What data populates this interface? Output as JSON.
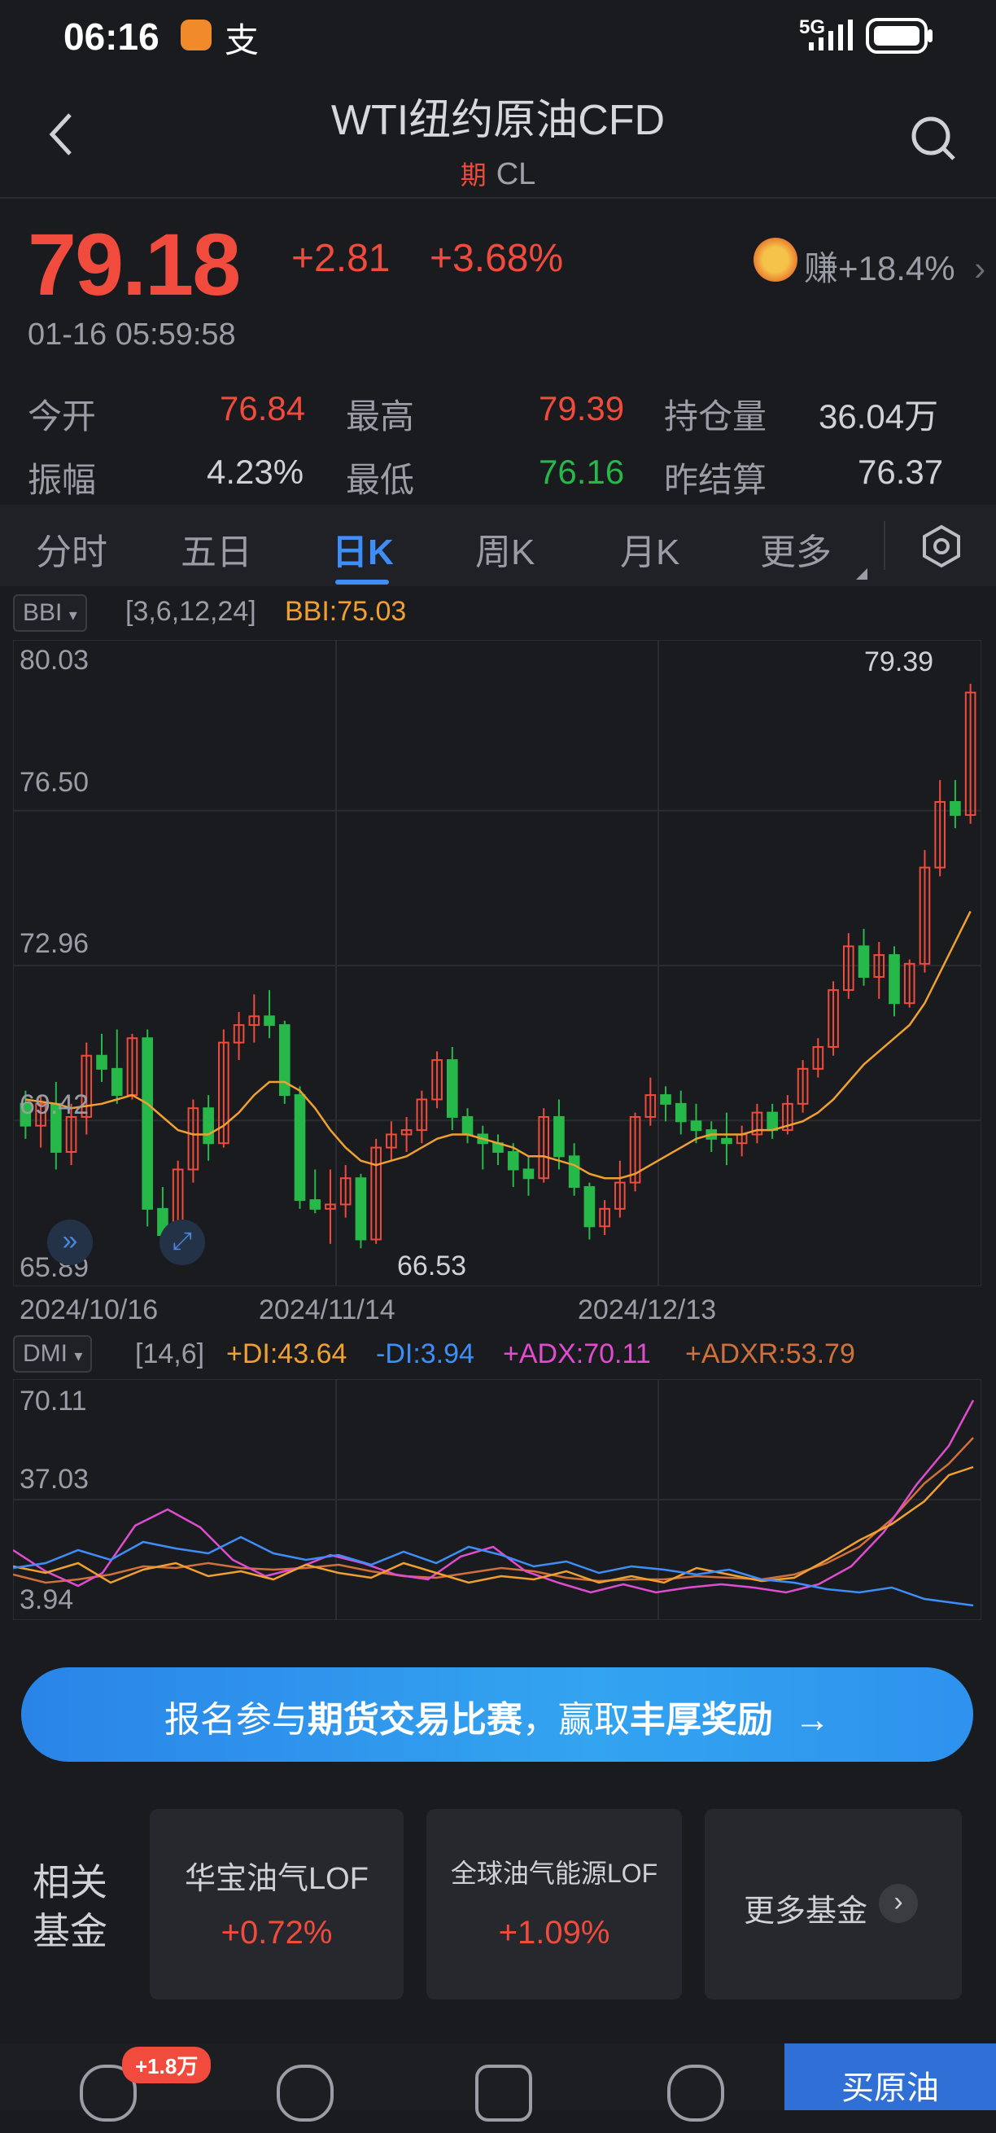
{
  "status_bar": {
    "time": "06:16",
    "signal": "5G"
  },
  "header": {
    "title": "WTI纽约原油CFD",
    "badge": "期",
    "code": "CL"
  },
  "quote": {
    "price": "79.18",
    "change": "+2.81",
    "change_pct": "+3.68%",
    "timestamp": "01-16 05:59:58",
    "earn_label": "赚+18.4%"
  },
  "stats": [
    {
      "label": "今开",
      "value": "76.84",
      "color": "red"
    },
    {
      "label": "最高",
      "value": "79.39",
      "color": "red"
    },
    {
      "label": "持仓量",
      "value": "36.04万",
      "color": "neutral"
    },
    {
      "label": "振幅",
      "value": "4.23%",
      "color": "neutral"
    },
    {
      "label": "最低",
      "value": "76.16",
      "color": "green"
    },
    {
      "label": "昨结算",
      "value": "76.37",
      "color": "neutral"
    }
  ],
  "tabs": [
    "分时",
    "五日",
    "日K",
    "周K",
    "月K",
    "更多"
  ],
  "active_tab": "日K",
  "main_indicator": {
    "name": "BBI",
    "params": "[3,6,12,24]",
    "value": "BBI:75.03"
  },
  "price_axis": [
    "80.03",
    "76.50",
    "72.96",
    "69.42",
    "65.89"
  ],
  "max_marker": "79.39",
  "min_marker": "66.53",
  "date_axis": [
    "2024/10/16",
    "2024/11/14",
    "2024/12/13"
  ],
  "dmi": {
    "name": "DMI",
    "params": "[14,6]",
    "pdi": "+DI:43.64",
    "mdi": "-DI:3.94",
    "adx": "+ADX:70.11",
    "adxr": "+ADXR:53.79",
    "axis": [
      "70.11",
      "37.03",
      "3.94"
    ]
  },
  "colors": {
    "up": "#f04b3c",
    "down": "#27b84a",
    "bbi": "#f0a030",
    "pdi": "#f0a030",
    "mdi": "#3e8ef7",
    "adx": "#e04cd0",
    "adxr": "#d0703a",
    "accent": "#3e8ef7"
  },
  "chart_data": {
    "type": "candlestick",
    "ylim": [
      65.89,
      80.03
    ],
    "ohlc": [
      [
        69.8,
        70.1,
        69.0,
        69.3
      ],
      [
        69.3,
        70.0,
        68.8,
        69.8
      ],
      [
        69.8,
        70.3,
        68.3,
        68.7
      ],
      [
        68.7,
        69.8,
        68.4,
        69.5
      ],
      [
        69.5,
        71.2,
        69.1,
        70.9
      ],
      [
        70.9,
        71.4,
        70.3,
        70.6
      ],
      [
        70.6,
        71.5,
        69.8,
        70.0
      ],
      [
        70.0,
        71.4,
        69.9,
        71.3
      ],
      [
        71.3,
        71.5,
        67.0,
        67.4
      ],
      [
        67.4,
        67.9,
        66.6,
        66.8
      ],
      [
        66.8,
        68.5,
        66.5,
        68.3
      ],
      [
        68.3,
        69.9,
        68.0,
        69.7
      ],
      [
        69.7,
        70.0,
        68.5,
        68.9
      ],
      [
        68.9,
        71.5,
        68.8,
        71.2
      ],
      [
        71.2,
        71.9,
        70.8,
        71.6
      ],
      [
        71.6,
        72.3,
        71.2,
        71.8
      ],
      [
        71.8,
        72.4,
        71.3,
        71.6
      ],
      [
        71.6,
        71.7,
        69.8,
        70.0
      ],
      [
        70.0,
        70.2,
        67.4,
        67.6
      ],
      [
        67.6,
        68.3,
        67.3,
        67.4
      ],
      [
        67.4,
        68.3,
        66.6,
        67.5
      ],
      [
        67.5,
        68.4,
        67.2,
        68.1
      ],
      [
        68.1,
        68.2,
        66.5,
        66.7
      ],
      [
        66.7,
        69.0,
        66.6,
        68.8
      ],
      [
        68.8,
        69.4,
        68.5,
        69.1
      ],
      [
        69.1,
        69.5,
        68.7,
        69.2
      ],
      [
        69.2,
        70.1,
        68.9,
        69.9
      ],
      [
        69.9,
        71.0,
        69.7,
        70.8
      ],
      [
        70.8,
        71.1,
        69.2,
        69.5
      ],
      [
        69.5,
        69.7,
        68.9,
        69.1
      ],
      [
        69.1,
        69.3,
        68.3,
        68.9
      ],
      [
        68.9,
        69.1,
        68.4,
        68.7
      ],
      [
        68.7,
        68.9,
        67.9,
        68.3
      ],
      [
        68.3,
        68.6,
        67.7,
        68.1
      ],
      [
        68.1,
        69.7,
        68.0,
        69.5
      ],
      [
        69.5,
        69.9,
        68.3,
        68.6
      ],
      [
        68.6,
        68.9,
        67.7,
        67.9
      ],
      [
        67.9,
        68.0,
        66.7,
        67.0
      ],
      [
        67.0,
        67.6,
        66.8,
        67.4
      ],
      [
        67.4,
        68.5,
        67.2,
        68.0
      ],
      [
        68.0,
        69.6,
        67.8,
        69.5
      ],
      [
        69.5,
        70.4,
        69.3,
        70.0
      ],
      [
        70.0,
        70.2,
        69.4,
        69.8
      ],
      [
        69.8,
        70.1,
        69.1,
        69.4
      ],
      [
        69.4,
        69.8,
        68.9,
        69.2
      ],
      [
        69.2,
        69.4,
        68.7,
        69.0
      ],
      [
        69.0,
        69.6,
        68.4,
        68.9
      ],
      [
        68.9,
        69.3,
        68.6,
        69.1
      ],
      [
        69.1,
        69.8,
        68.9,
        69.6
      ],
      [
        69.6,
        69.8,
        69.0,
        69.2
      ],
      [
        69.2,
        70.0,
        69.1,
        69.8
      ],
      [
        69.8,
        70.8,
        69.6,
        70.6
      ],
      [
        70.6,
        71.3,
        70.4,
        71.1
      ],
      [
        71.1,
        72.6,
        70.9,
        72.4
      ],
      [
        72.4,
        73.7,
        72.2,
        73.4
      ],
      [
        73.4,
        73.8,
        72.5,
        72.7
      ],
      [
        72.7,
        73.5,
        72.2,
        73.2
      ],
      [
        73.2,
        73.4,
        71.8,
        72.1
      ],
      [
        72.1,
        73.1,
        72.0,
        73.0
      ],
      [
        73.0,
        75.6,
        72.8,
        75.2
      ],
      [
        75.2,
        77.2,
        75.0,
        76.7
      ],
      [
        76.7,
        77.2,
        76.1,
        76.4
      ],
      [
        76.4,
        79.4,
        76.2,
        79.2
      ]
    ],
    "bbi": [
      69.9,
      69.85,
      69.8,
      69.7,
      69.75,
      69.8,
      69.9,
      70.0,
      69.8,
      69.5,
      69.2,
      69.1,
      69.1,
      69.3,
      69.6,
      70.0,
      70.3,
      70.3,
      70.1,
      69.7,
      69.2,
      68.8,
      68.5,
      68.4,
      68.5,
      68.6,
      68.8,
      69.0,
      69.1,
      69.1,
      69.0,
      68.9,
      68.8,
      68.6,
      68.6,
      68.5,
      68.4,
      68.2,
      68.1,
      68.1,
      68.2,
      68.4,
      68.6,
      68.8,
      69.0,
      69.1,
      69.1,
      69.1,
      69.2,
      69.2,
      69.3,
      69.4,
      69.6,
      69.9,
      70.3,
      70.7,
      71.0,
      71.3,
      71.6,
      72.1,
      72.8,
      73.5,
      74.2
    ]
  }
}
